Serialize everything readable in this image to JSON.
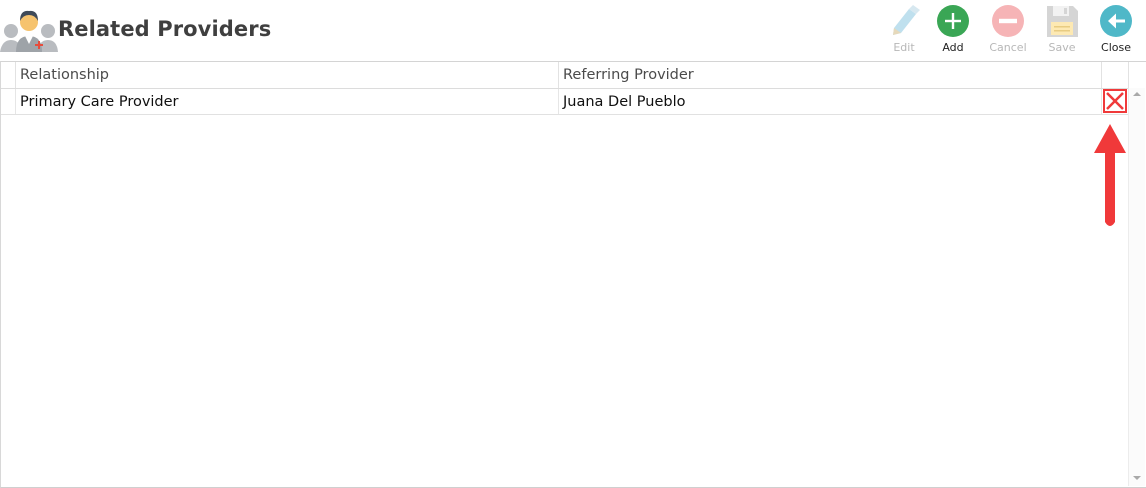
{
  "header": {
    "title": "Related Providers",
    "logo_icon": "doctor-avatar-icon"
  },
  "toolbar": {
    "edit": {
      "label": "Edit",
      "icon": "pencil-icon",
      "enabled": false
    },
    "add": {
      "label": "Add",
      "icon": "plus-circle-icon",
      "enabled": true,
      "color": "#3aa655"
    },
    "cancel": {
      "label": "Cancel",
      "icon": "minus-circle-icon",
      "enabled": false
    },
    "save": {
      "label": "Save",
      "icon": "floppy-disk-icon",
      "enabled": false
    },
    "close": {
      "label": "Close",
      "icon": "arrow-left-circle-icon",
      "enabled": true,
      "color": "#4fb8c8"
    }
  },
  "grid": {
    "columns": [
      "Relationship",
      "Referring Provider"
    ],
    "rows": [
      {
        "relationship": "Primary Care Provider",
        "referring_provider": "Juana  Del Pueblo",
        "delete_icon": "delete-x-icon"
      }
    ]
  },
  "annotation": {
    "icon": "red-arrow-icon",
    "color": "#f0393a"
  }
}
